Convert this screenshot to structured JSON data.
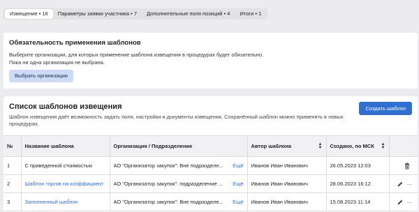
{
  "tabs": [
    {
      "label": "Извещение • 16",
      "active": true
    },
    {
      "label": "Параметры заявки участника • 7",
      "active": false
    },
    {
      "label": "Дополнительные поля позиций • 4",
      "active": false
    },
    {
      "label": "Итоги • 1",
      "active": false
    }
  ],
  "mandatory": {
    "title": "Обязательность применения шаблонов",
    "line1": "Выберите организации, для которых применение шаблона извещения в процедурах будет обязательно.",
    "line2": "Пока ни одна организация не выбрана.",
    "button": "Выбрать организации"
  },
  "templates": {
    "title": "Список шаблонов извещения",
    "description": "Шаблон извещения даёт возможность задать поля, настройки и документы извещения. Сохранённый шаблон можно применять в новых процедурах.",
    "create_button": "Создать шаблон",
    "columns": {
      "num": "№",
      "name": "Название шаблона",
      "org": "Организация / Подразделение",
      "author": "Автор шаблона",
      "created": "Создано, по МСК"
    },
    "more_label": "Ещё",
    "rows": [
      {
        "num": "1",
        "name": "С приведенной стоимостью",
        "name_link": false,
        "org": "АО \"Организатор закупок\": Вне подразделе...",
        "author": "Иванов Иван Иванович",
        "created": "26.05.2023 12:03",
        "editable": false
      },
      {
        "num": "2",
        "name": "Шаблон торгов на коэффициент",
        "name_link": true,
        "org": "АО \"Организатор закупок\": подразделение ...",
        "author": "Иванов Иван Иванович",
        "created": "28.06.2023 16:12",
        "editable": true
      },
      {
        "num": "3",
        "name": "Заполненный шаблон",
        "name_link": true,
        "org": "АО \"Организатор закупок\": Вне подразделе...",
        "author": "Иванов Иван Иванович",
        "created": "15.08.2023 11:14",
        "editable": true
      }
    ]
  },
  "colors": {
    "accent": "#2f6fd1",
    "light_button": "#cddcf6",
    "background": "#ececee"
  }
}
